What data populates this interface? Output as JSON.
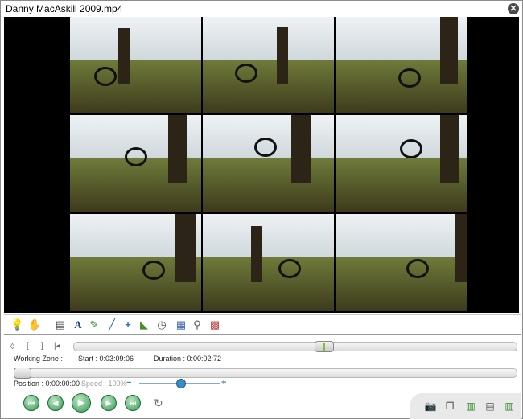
{
  "window": {
    "title": "Danny MacAskill 2009.mp4",
    "close_glyph": "✕"
  },
  "video": {
    "frames": [
      {
        "name": "frame-1"
      },
      {
        "name": "frame-2"
      },
      {
        "name": "frame-3"
      },
      {
        "name": "frame-4"
      },
      {
        "name": "frame-5"
      },
      {
        "name": "frame-6"
      },
      {
        "name": "frame-7"
      },
      {
        "name": "frame-8"
      },
      {
        "name": "frame-9"
      }
    ]
  },
  "toolbar": {
    "tools": [
      {
        "name": "bulb-icon",
        "glyph": "💡"
      },
      {
        "name": "hand-icon",
        "glyph": "✋"
      },
      {
        "name": "page-icon",
        "glyph": "▤"
      },
      {
        "name": "text-icon",
        "glyph": "A"
      },
      {
        "name": "pencil-icon",
        "glyph": "✎"
      },
      {
        "name": "line-icon",
        "glyph": "╱"
      },
      {
        "name": "cross-icon",
        "glyph": "+"
      },
      {
        "name": "angle-icon",
        "glyph": "◣"
      },
      {
        "name": "chrono-icon",
        "glyph": "◷"
      },
      {
        "name": "grid-icon",
        "glyph": "▦"
      },
      {
        "name": "magnifier-icon",
        "glyph": "⚲"
      },
      {
        "name": "color-icon",
        "glyph": "▩"
      }
    ]
  },
  "working_zone": {
    "label": "Working Zone :",
    "start_label": "Start : 0:03:09:06",
    "duration_label": "Duration : 0:00:02:72",
    "icons": [
      "◊",
      "[",
      "]",
      "|◂"
    ]
  },
  "position": {
    "label": "Position : 0:00:00:00",
    "speed_label": "Speed : 100%",
    "minus": "−",
    "plus": "+"
  },
  "playback": {
    "buttons": [
      {
        "name": "first-frame-button",
        "glyph": "⏮"
      },
      {
        "name": "previous-frame-button",
        "glyph": "◀"
      },
      {
        "name": "play-button",
        "glyph": "▶"
      },
      {
        "name": "next-frame-button",
        "glyph": "▶"
      },
      {
        "name": "last-frame-button",
        "glyph": "⏭"
      }
    ],
    "undo_glyph": "↻"
  },
  "corner": {
    "buttons": [
      {
        "name": "snapshot-icon",
        "glyph": "📷"
      },
      {
        "name": "multi-snapshot-icon",
        "glyph": "❐"
      },
      {
        "name": "export-video-icon",
        "glyph": "▥"
      },
      {
        "name": "export-slideshow-icon",
        "glyph": "▤"
      },
      {
        "name": "export-diptych-icon",
        "glyph": "▥"
      }
    ]
  },
  "colors": {
    "accent_green": "#2f9a52",
    "speed_blue": "#3a8cc7"
  }
}
